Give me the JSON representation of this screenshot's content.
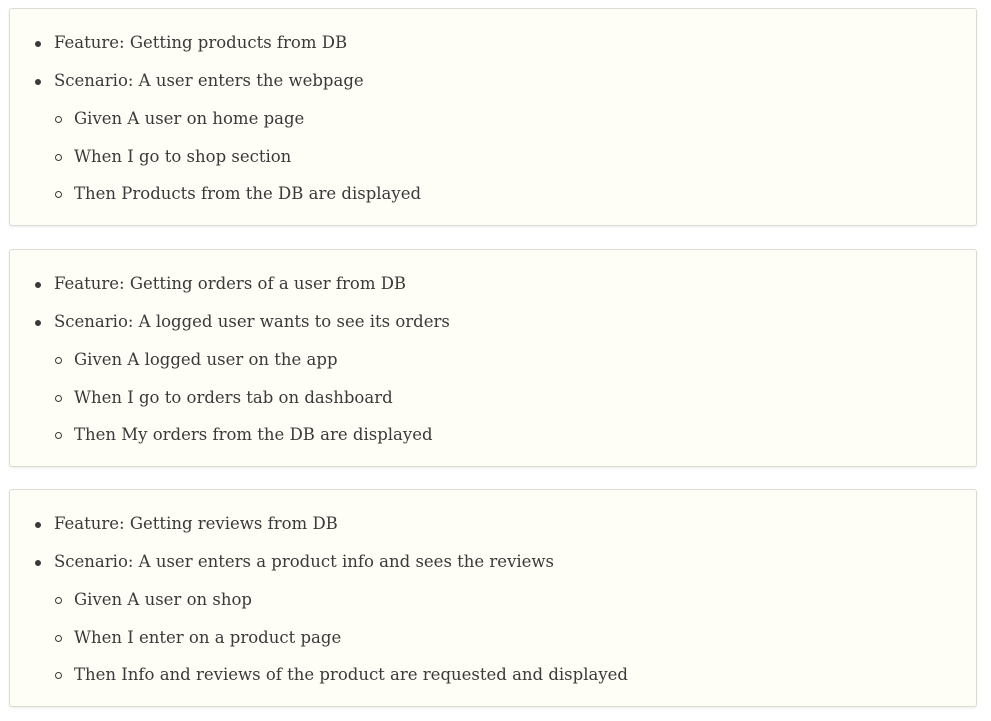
{
  "cards": [
    {
      "feature": "Feature: Getting products from DB",
      "scenario": "Scenario: A user enters the webpage",
      "steps": [
        "Given A user on home page",
        "When I go to shop section",
        "Then Products from the DB are displayed"
      ]
    },
    {
      "feature": "Feature: Getting orders of a user from DB",
      "scenario": "Scenario: A logged user wants to see its orders",
      "steps": [
        "Given A logged user on the app",
        "When I go to orders tab on dashboard",
        "Then My orders from the DB are displayed"
      ]
    },
    {
      "feature": "Feature: Getting reviews from DB",
      "scenario": "Scenario: A user enters a product info and sees the reviews",
      "steps": [
        "Given A user on shop",
        "When I enter on a product page",
        "Then Info and reviews of the product are requested and displayed"
      ]
    }
  ]
}
